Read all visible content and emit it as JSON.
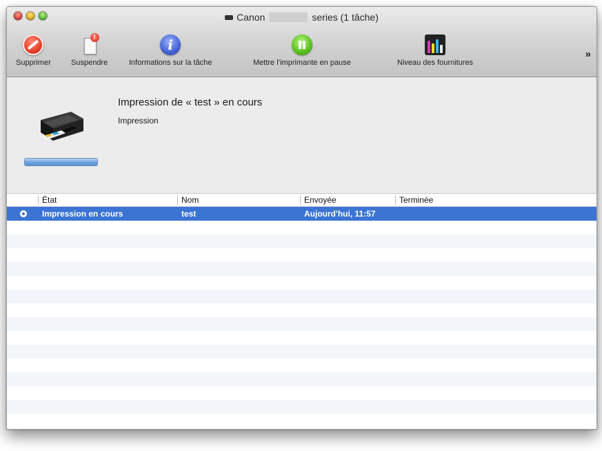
{
  "window": {
    "title_prefix": "Canon",
    "title_suffix": "series (1 tâche)"
  },
  "toolbar": {
    "delete_label": "Supprimer",
    "suspend_label": "Suspendre",
    "info_label": "Informations sur la tâche",
    "pause_label": "Mettre l’imprimante en pause",
    "supplies_label": "Niveau des fournitures",
    "overflow_label": "»"
  },
  "status": {
    "job_title": "Impression de « test » en cours",
    "job_subtitle": "Impression",
    "progress_fraction": 1.0
  },
  "table": {
    "columns": [
      "État",
      "Nom",
      "Envoyée",
      "Terminée"
    ],
    "rows": [
      {
        "state": "Impression en cours",
        "name": "test",
        "sent": "Aujourd'hui, 11:57",
        "done": ""
      }
    ]
  },
  "colors": {
    "selection": "#3b74d3",
    "status_bg": "#ececec"
  }
}
